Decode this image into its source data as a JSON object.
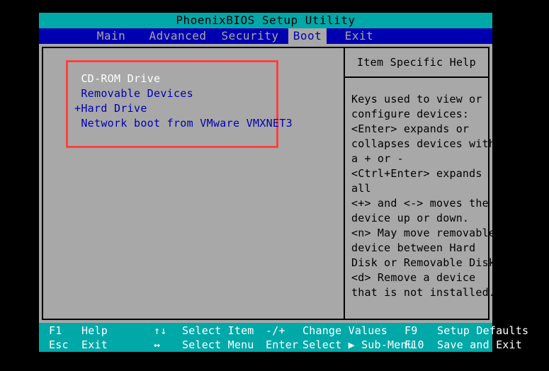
{
  "screen": {
    "title": "PhoenixBIOS Setup Utility",
    "colors": {
      "title_bg": "#00a8a8",
      "menu_bg": "#0000b0",
      "panel_bg": "#a8a8a8",
      "item_text": "#0000b0",
      "selected_text": "#ffffff",
      "highlight_box": "#ff4040",
      "footer_bg": "#00a8a8"
    }
  },
  "menu": {
    "tabs": [
      {
        "label": "Main",
        "active": false
      },
      {
        "label": "Advanced",
        "active": false
      },
      {
        "label": "Security",
        "active": false
      },
      {
        "label": "Boot",
        "active": true
      },
      {
        "label": "Exit",
        "active": false
      }
    ]
  },
  "boot_order": {
    "items": [
      {
        "prefix": " ",
        "label": "CD-ROM Drive",
        "selected": true
      },
      {
        "prefix": " ",
        "label": "Removable Devices",
        "selected": false
      },
      {
        "prefix": "+",
        "label": "Hard Drive",
        "selected": false
      },
      {
        "prefix": " ",
        "label": "Network boot from VMware VMXNET3",
        "selected": false
      }
    ]
  },
  "help": {
    "title": "Item Specific Help",
    "lines": [
      "Keys used to view or",
      "configure devices:",
      "<Enter> expands or",
      "collapses devices with",
      "a + or -",
      "<Ctrl+Enter> expands",
      "all",
      "<+> and <-> moves the",
      "device up or down.",
      "<n> May move removable",
      "device between Hard",
      "Disk or Removable Disk",
      "<d> Remove a device",
      "that is not installed."
    ]
  },
  "footer": {
    "row1": {
      "key": "F1",
      "action": "Help",
      "nav": "↑↓",
      "nav_desc": "Select Item",
      "change": "-/+",
      "change_desc": "Change Values",
      "fn": "F9",
      "fn_desc": "Setup Defaults"
    },
    "row2": {
      "key": "Esc",
      "action": "Exit",
      "nav": "↔",
      "nav_desc": "Select Menu",
      "change": "Enter",
      "change_desc": "Select ▶ Sub-Menu",
      "fn": "F10",
      "fn_desc": "Save and Exit"
    }
  }
}
